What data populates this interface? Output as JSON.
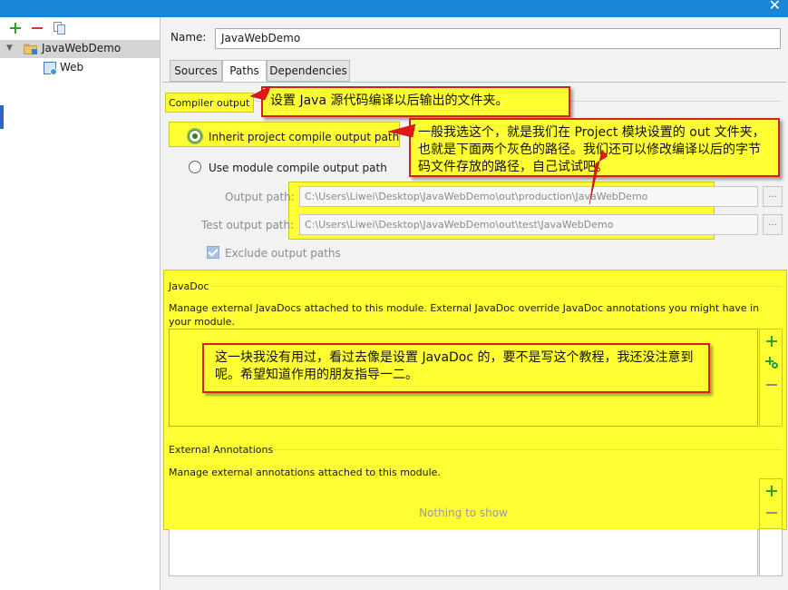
{
  "window": {
    "close_glyph": "✕"
  },
  "toolbar": {
    "add_icon": "plus-icon",
    "remove_icon": "minus-icon",
    "copy_icon": "copy-icon"
  },
  "tree": {
    "expand_glyph": "▼",
    "root": {
      "label": "JavaWebDemo",
      "icon": "module-folder-icon"
    },
    "child": {
      "label": "Web",
      "icon": "web-facet-icon"
    }
  },
  "name": {
    "label": "Name:",
    "value": "JavaWebDemo"
  },
  "tabs": [
    {
      "label": "Sources",
      "active": false
    },
    {
      "label": "Paths",
      "active": true
    },
    {
      "label": "Dependencies",
      "active": false
    }
  ],
  "compiler_output": {
    "label": "Compiler output",
    "inherit_label": "Inherit project compile output path",
    "inherit_selected": true,
    "module_label": "Use module compile output path",
    "output_path_label": "Output path:",
    "output_path_value": "C:\\Users\\Liwei\\Desktop\\JavaWebDemo\\out\\production\\JavaWebDemo",
    "test_path_label": "Test output path:",
    "test_path_value": "C:\\Users\\Liwei\\Desktop\\JavaWebDemo\\out\\test\\JavaWebDemo",
    "browse_label": "...",
    "exclude_label": "Exclude output paths",
    "exclude_checked": true
  },
  "javadoc": {
    "title": "JavaDoc",
    "description": "Manage external JavaDocs attached to this module. External JavaDoc override JavaDoc annotations you might have in your module."
  },
  "external_annotations": {
    "title": "External Annotations",
    "description": "Manage external annotations attached to this module.",
    "empty_text": "Nothing to show"
  },
  "callouts": {
    "compiler_output": "设置 Java 源代码编译以后输出的文件夹。",
    "inherit": "一般我选这个，就是我们在 Project 模块设置的 out 文件夹，也就是下面两个灰色的路径。我们还可以修改编译以后的字节码文件存放的路径，自己试试吧。",
    "javadoc": "这一块我没有用过，看过去像是设置 JavaDoc 的，要不是写这个教程，我还没注意到呢。希望知道作用的朋友指导一二。"
  },
  "colors": {
    "highlight": "#ffff33",
    "callout_border": "#d02020",
    "accent_blue": "#1a86d8"
  }
}
